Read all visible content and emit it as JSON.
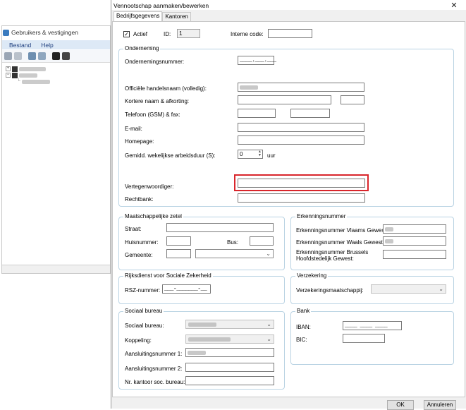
{
  "background_app": {
    "title": "Gebruikers & vestigingen",
    "menu": [
      "Bestand",
      "Help"
    ]
  },
  "dialog": {
    "title": "Vennootschap aanmaken/bewerken",
    "close_icon": "close-icon",
    "tabs": [
      "Bedrijfsgegevens",
      "Kantoren"
    ],
    "active_tab": "Bedrijfsgegevens",
    "top": {
      "actief_label": "Actief",
      "actief_checked": true,
      "id_label": "ID:",
      "id_value": "1",
      "interne_code_label": "Interne code:",
      "interne_code_value": ""
    },
    "onderneming": {
      "title": "Onderneming",
      "ondernemingsnummer_label": "Ondernemingsnummer:",
      "ondernemingsnummer_mask": "____.___.___",
      "handelsnaam_label": "Officiële handelsnaam (volledig):",
      "kortere_naam_label": "Kortere naam & afkorting:",
      "telefoon_label": "Telefoon (GSM) & fax:",
      "email_label": "E-mail:",
      "homepage_label": "Homepage:",
      "arbeidsduur_label": "Gemidd. wekelijkse arbeidsduur (S):",
      "arbeidsduur_value": "0",
      "arbeidsduur_unit": "uur",
      "vertegenwoordiger_label": "Vertegenwoordiger:",
      "rechtbank_label": "Rechtbank:"
    },
    "maatschappelijke_zetel": {
      "title": "Maatschappelijke zetel",
      "straat_label": "Straat:",
      "huisnummer_label": "Huisnummer:",
      "bus_label": "Bus:",
      "gemeente_label": "Gemeente:"
    },
    "erkenningsnummer": {
      "title": "Erkenningsnummer",
      "vlaams_label": "Erkenningsnummer Vlaams Gewest:",
      "waals_label": "Erkenningsnummer Waals Gewest:",
      "brussels_label_1": "Erkenningsnummer Brussels",
      "brussels_label_2": "Hoofdstedelijk Gewest:"
    },
    "rsz": {
      "title": "Rijksdienst voor Sociale Zekerheid",
      "rsz_label": "RSZ-nummer:",
      "rsz_mask": "___-_______-__"
    },
    "verzekering": {
      "title": "Verzekering",
      "maatschappij_label": "Verzekeringsmaatschappij:"
    },
    "sociaal_bureau": {
      "title": "Sociaal bureau",
      "bureau_label": "Sociaal bureau:",
      "koppeling_label": "Koppeling:",
      "aansluiting1_label": "Aansluitingsnummer 1:",
      "aansluiting2_label": "Aansluitingsnummer 2:",
      "kantoor_label": "Nr. kantoor soc. bureau:"
    },
    "bank": {
      "title": "Bank",
      "iban_label": "IBAN:",
      "iban_mask": "____ ____ ____ ____",
      "bic_label": "BIC:"
    },
    "footer": {
      "ok_label": "OK",
      "annuleren_label": "Annuleren"
    }
  },
  "colors": {
    "group_border": "#b9d3e3",
    "highlight": "#d9262c",
    "menubar": "#dde9f6"
  }
}
